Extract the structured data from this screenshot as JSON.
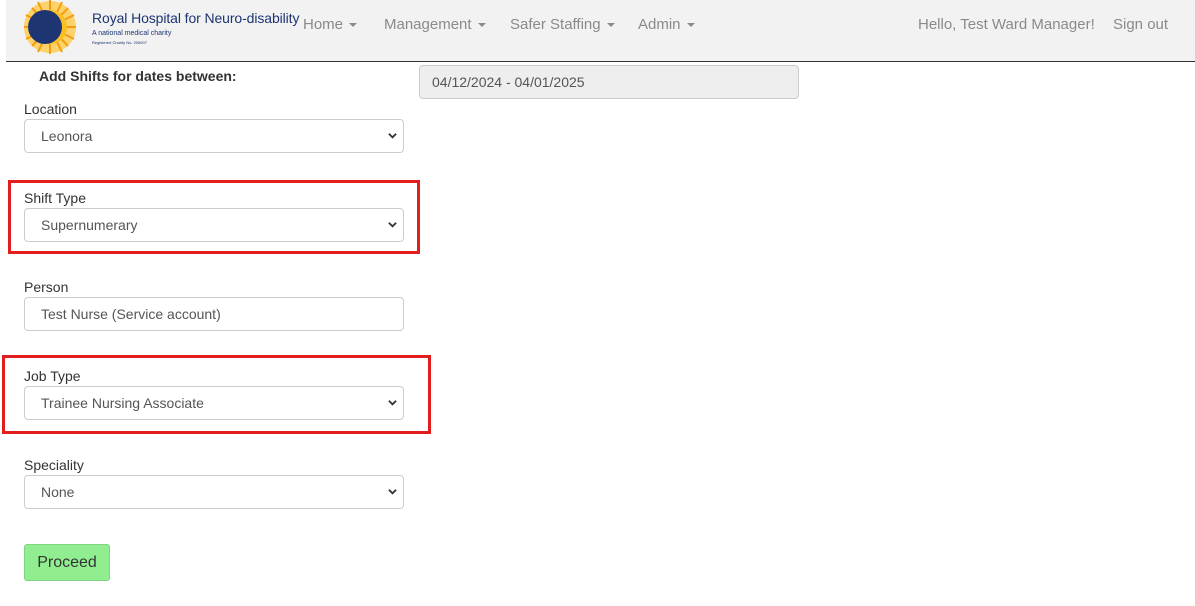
{
  "logo": {
    "name": "Royal Hospital for Neuro-disability",
    "tagline": "A national medical charity",
    "charity_no": "Registered Charity No. 205907"
  },
  "nav": {
    "items": [
      {
        "label": "Home"
      },
      {
        "label": "Management"
      },
      {
        "label": "Safer Staffing"
      },
      {
        "label": "Admin"
      }
    ],
    "greeting": "Hello, Test Ward Manager!",
    "sign_out": "Sign out"
  },
  "form": {
    "heading": "Add Shifts for dates between:",
    "date_range": "04/12/2024 - 04/01/2025",
    "location": {
      "label": "Location",
      "value": "Leonora"
    },
    "shift_type": {
      "label": "Shift Type",
      "value": "Supernumerary"
    },
    "person": {
      "label": "Person",
      "value": "Test Nurse (Service account)"
    },
    "job_type": {
      "label": "Job Type",
      "value": "Trainee Nursing Associate"
    },
    "speciality": {
      "label": "Speciality",
      "value": "None"
    },
    "proceed": "Proceed"
  },
  "colors": {
    "nav_bg": "#f2f2f2",
    "brand": "#1d3572",
    "highlight": "#e21d1d",
    "proceed": "#90ee90"
  },
  "icons": {
    "logo": "sun-logo-icon",
    "dropdown": "chevron-down-icon",
    "menu": "caret-down-icon"
  }
}
